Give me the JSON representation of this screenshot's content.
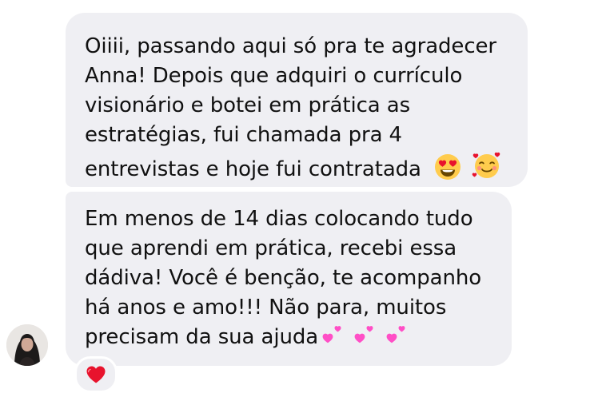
{
  "thread": {
    "messages": [
      {
        "lines": [
          "Oiiii, passando aqui só pra te agradecer",
          "Anna! Depois que adquiri o currículo",
          "visionário e botei em prática as",
          "estratégias, fui chamada pra 4",
          "entrevistas e hoje fui contratada"
        ],
        "emojis": [
          "heart-eyes-emoji",
          "smiling-face-with-hearts-emoji"
        ]
      },
      {
        "lines": [
          "Em menos de 14 dias colocando tudo",
          "que aprendi em prática, recebi essa",
          "dádiva! Você é benção, te acompanho",
          "há anos e amo!!! Não para, muitos",
          "precisam da sua ajuda"
        ],
        "emojis": [
          "two-hearts-emoji",
          "two-hearts-emoji",
          "two-hearts-emoji"
        ]
      }
    ],
    "reaction": {
      "icon": "red-heart-icon"
    }
  },
  "colors": {
    "bubble": "#efeff3",
    "text": "#111111",
    "heart": "#e8132d",
    "pink": "#ff4fc6"
  }
}
